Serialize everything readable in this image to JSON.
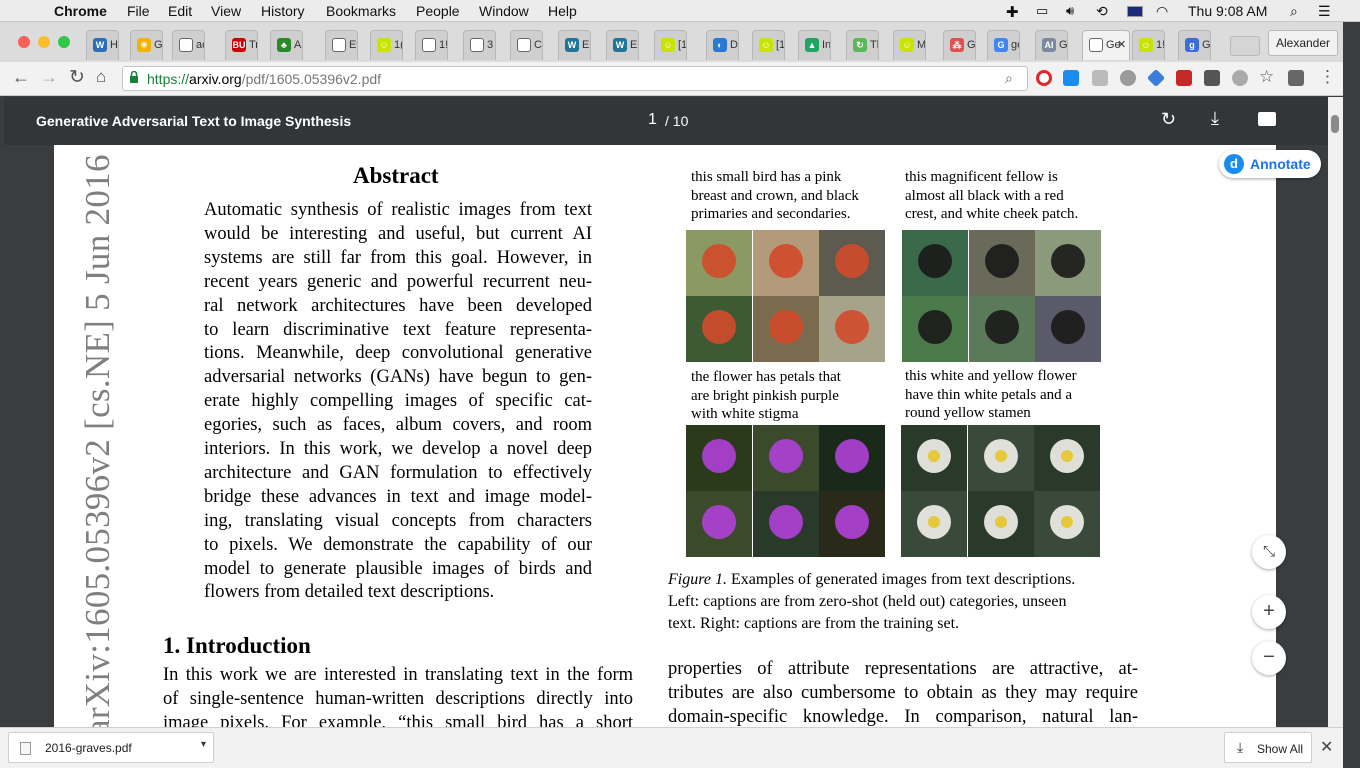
{
  "menubar": {
    "app": "Chrome",
    "items": [
      "File",
      "Edit",
      "View",
      "History",
      "Bookmarks",
      "People",
      "Window",
      "Help"
    ],
    "clock": "Thu 9:08 AM"
  },
  "tabs": [
    {
      "icon": "W",
      "color": "#2c6fb8",
      "title": "H"
    },
    {
      "icon": "☀",
      "color": "#f2b300",
      "title": "G"
    },
    {
      "icon": "",
      "color": "#fff",
      "title": "ac"
    },
    {
      "icon": "BU",
      "color": "#cc0000",
      "title": "Tr"
    },
    {
      "icon": "♣",
      "color": "#2a8a2a",
      "title": "A|"
    },
    {
      "icon": "",
      "color": "#fff",
      "title": "Et"
    },
    {
      "icon": "☺",
      "color": "#c8e400",
      "title": "1("
    },
    {
      "icon": "",
      "color": "#fff",
      "title": "1!"
    },
    {
      "icon": "",
      "color": "#fff",
      "title": "3"
    },
    {
      "icon": "",
      "color": "#fff",
      "title": "Cr"
    },
    {
      "icon": "W",
      "color": "#21759b",
      "title": "Ec"
    },
    {
      "icon": "W",
      "color": "#21759b",
      "title": "Ec"
    },
    {
      "icon": "☺",
      "color": "#c8e400",
      "title": "[1"
    },
    {
      "icon": "◐",
      "color": "#2a7ad5",
      "title": "D"
    },
    {
      "icon": "☺",
      "color": "#c8e400",
      "title": "[1"
    },
    {
      "icon": "▲",
      "color": "#1fa463",
      "title": "In"
    },
    {
      "icon": "↻",
      "color": "#5cb85c",
      "title": "Tl"
    },
    {
      "icon": "☺",
      "color": "#c8e400",
      "title": "M"
    },
    {
      "icon": "⁂",
      "color": "#e05050",
      "title": "G"
    },
    {
      "icon": "G",
      "color": "#4285f4",
      "title": "ge"
    },
    {
      "icon": "AI",
      "color": "#7a8aa0",
      "title": "G"
    },
    {
      "icon": "",
      "color": "#fff",
      "title": "Ge"
    },
    {
      "icon": "☺",
      "color": "#c8e400",
      "title": "1!"
    },
    {
      "icon": "g",
      "color": "#3b6fd8",
      "title": "G"
    }
  ],
  "profile": "Alexander",
  "url": {
    "secure": "https://",
    "host": "arxiv.org",
    "path": "/pdf/1605.05396v2.pdf"
  },
  "pdf": {
    "title": "Generative Adversarial Text to Image Synthesis",
    "page_current": "1",
    "page_total": "/ 10",
    "annotate_label": "Annotate",
    "arxiv_stamp": "arXiv:1605.05396v2  [cs.NE]  5 Jun 2016",
    "abstract_heading": "Abstract",
    "abstract_lines": [
      "Automatic synthesis of realistic images from text",
      "would be interesting and useful, but current AI",
      "systems are still far from this goal.  However, in",
      "recent years generic and powerful recurrent neu-",
      "ral network architectures have been developed",
      "to learn discriminative text feature representa-",
      "tions. Meanwhile, deep convolutional generative",
      "adversarial networks (GANs) have begun to gen-",
      "erate highly compelling images of specific cat-",
      "egories, such as faces, album covers, and room",
      "interiors.  In this work, we develop a novel deep",
      "architecture and GAN formulation to effectively",
      "bridge these advances in text and image model-",
      "ing, translating visual concepts from characters",
      "to pixels.  We demonstrate the capability of our",
      "model to generate plausible images of birds and",
      "flowers from detailed text descriptions."
    ],
    "intro_heading": "1. Introduction",
    "intro_lines": [
      "In this work we are interested in translating text in the form",
      "of single-sentence human-written descriptions directly into",
      "image pixels.  For example, “this small bird has a short"
    ],
    "captions": [
      [
        "this small bird has a pink",
        "breast and crown, and black",
        "primaries and secondaries."
      ],
      [
        "this magnificent fellow is",
        "almost all black with a red",
        "crest, and white cheek patch."
      ],
      [
        "the flower has petals that",
        "are bright pinkish purple",
        "with white stigma"
      ],
      [
        "this white and yellow flower",
        "have thin white petals and a",
        "round yellow stamen"
      ]
    ],
    "figure_label": "Figure 1.",
    "figure_caption_lines": [
      "Examples of generated images from text descriptions.",
      "Left:  captions are from zero-shot (held out) categories, unseen",
      "text. Right: captions are from the training set."
    ],
    "right_body_lines": [
      "properties of attribute representations are attractive, at-",
      "tributes are also cumbersome to obtain as they may require",
      "domain-specific knowledge.  In comparison, natural lan-"
    ]
  },
  "download": {
    "filename": "2016-graves.pdf",
    "show_all": "Show All"
  },
  "colors": {
    "pdf_toolbar": "#323639",
    "accent": "#1a73e8",
    "secure_green": "#188038"
  }
}
